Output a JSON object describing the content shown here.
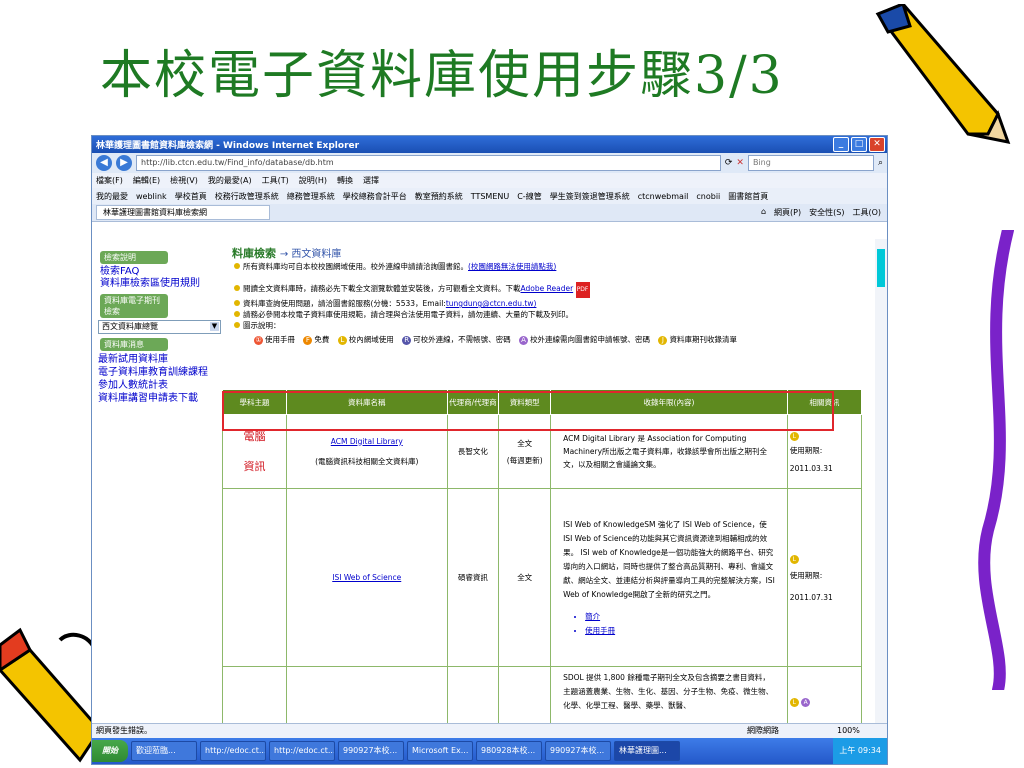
{
  "slide": {
    "title": "本校電子資料庫使用步驟3/3"
  },
  "browser": {
    "title": "林華護理圖書館資料庫檢索網 - Windows Internet Explorer",
    "url": "http://lib.ctcn.edu.tw/Find_info/database/db.htm",
    "search_placeholder": "Bing",
    "menu": [
      "檔案(F)",
      "編輯(E)",
      "檢視(V)",
      "我的最愛(A)",
      "工具(T)",
      "說明(H)",
      "轉換",
      "選擇"
    ],
    "favorites": [
      "我的最愛",
      "weblink",
      "學校首頁",
      "校務行政管理系統",
      "總務管理系統",
      "學校總務會計平台",
      "教室預約系統",
      "TTSMENU",
      "C-線管",
      "學生簽到簽退管理系統",
      "ctcnwebmail",
      "cnobii",
      "圖書館首頁"
    ],
    "tab_label": "林華護理圖書館資料庫檢索網",
    "tab_tools": [
      "網頁(P)",
      "安全性(S)",
      "工具(O)"
    ],
    "status_text": "網頁發生錯誤。",
    "status_zone": "網際網路",
    "zoom": "100%",
    "taskbar": {
      "start": "開始",
      "tasks": [
        "歡迎蒞臨...",
        "http://edoc.ct...",
        "http://edoc.ct...",
        "990927本校...",
        "Microsoft Ex...",
        "980928本校...",
        "990927本校...",
        "林華護理圖..."
      ],
      "clock": "上午 09:34"
    }
  },
  "sidebar": {
    "heads": [
      "檢索說明",
      "資料庫電子期刊檢索",
      "資料庫消息"
    ],
    "faq_links": [
      "檢索FAQ",
      "資料庫檢索區使用規則"
    ],
    "select_value": "西文資料庫總覽",
    "news_links": [
      "最新試用資料庫",
      "電子資料庫教育訓練課程",
      "參加人數統計表",
      "資料庫講習申請表下載"
    ]
  },
  "main": {
    "breadcrumb": "料庫檢索",
    "breadcrumb_sub": "→ 西文資料庫",
    "notes": [
      "所有資料庫均可自本校校園網域使用。校外連線申請請洽詢圖書館。",
      "閱讀全文資料庫時，請務必先下載全文瀏覽軟體並安裝後，方可觀看全文資料。下載",
      "資料庫查詢使用問題，請洽圖書館服務(分機：5533，Email:",
      "請務必參閱本校電子資料庫使用規範，請合理與合法使用電子資料，請勿連續、大量的下載及列印。",
      "圖示說明："
    ],
    "note_links": [
      "(校園網路無法使用請點我)",
      "Adobe Reader",
      "tungdung@ctcn.edu.tw)",
      "本校電子資料庫使用規範"
    ],
    "legend": [
      "使用手冊",
      "免費",
      "校內網域使用",
      "可校外連線，不需帳號、密碼",
      "校外連線需向圖書館申請帳號、密碼",
      "資料庫期刊收錄清單"
    ]
  },
  "table": {
    "headers": [
      "學科主題",
      "資料庫名稱",
      "代理商/代理商",
      "資料類型",
      "收錄年限(內容)",
      "相關資訊"
    ],
    "rows": [
      {
        "subject": [
          "電腦",
          "資訊"
        ],
        "name": "ACM Digital Library",
        "name_note": "(電腦資訊科技相關全文資料庫)",
        "agent": "長智文化",
        "type": "全文",
        "type_note": "(每週更新)",
        "content": "ACM Digital Library 是 Association for Computing Machinery所出版之電子資料庫，收錄該學會所出版之期刊全文，以及相關之會議論文集。",
        "info_label": "使用期限:",
        "info_date": "2011.03.31"
      },
      {
        "subject": [],
        "name": "ISI  Web of Science",
        "name_note": "",
        "agent": "碩睿資訊",
        "type": "全文",
        "type_note": "",
        "content": "ISI Web of KnowledgeSM 強化了 ISI Web of Science，使ISI Web of Science的功能與其它資訊資源達到相輔相成的效果。 ISI web of Knowledge是一個功能強大的網路平台、研究導向的入口網站，同時也提供了整合高品質期刊、專利、會議文獻、網站全文、並連結分析與評量導向工具的完整解決方案，ISI Web of Knowledge開啟了全新的研究之門。",
        "links": [
          "簡介",
          "使用手冊"
        ],
        "info_label": "使用期限:",
        "info_date": "2011.07.31"
      },
      {
        "subject": [],
        "name": "",
        "name_note": "",
        "agent": "",
        "type": "",
        "type_note": "",
        "content": "SDOL 提供 1,800 餘種電子期刊全文及包含摘要之書目資料，主題涵蓋農業、生物、生化、基因、分子生物、免疫、微生物、化學、化學工程、醫學、藥學、獸醫、",
        "info_label": "",
        "info_date": ""
      }
    ]
  },
  "colors": {
    "title": "#1e7a23",
    "table_header": "#5e8a1f",
    "highlight_box": "#e0262c",
    "taskbar": "#2458c9"
  }
}
